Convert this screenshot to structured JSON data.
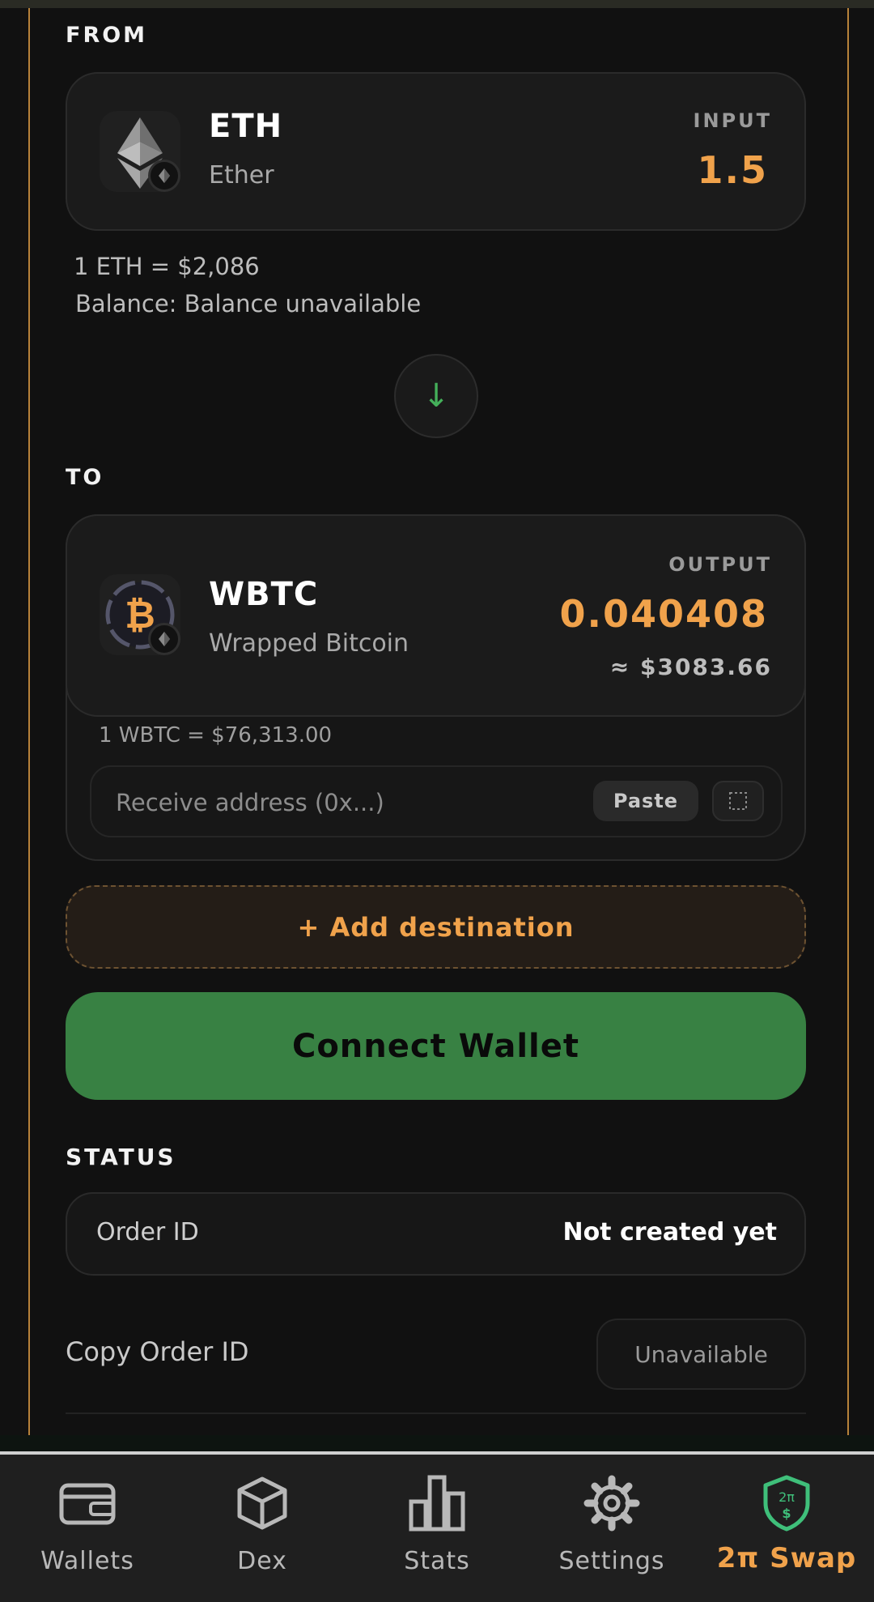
{
  "from": {
    "section_label": "FROM",
    "token_symbol": "ETH",
    "token_name": "Ether",
    "io_label": "INPUT",
    "amount": "1.5",
    "rate": "1 ETH = $2,086",
    "balance": "Balance: Balance unavailable"
  },
  "swap_direction_icon": "arrow-down-icon",
  "to": {
    "section_label": "TO",
    "token_symbol": "WBTC",
    "token_name": "Wrapped Bitcoin",
    "io_label": "OUTPUT",
    "amount": "0.040408",
    "usd_value": "≈ $3083.66",
    "rate": "1 WBTC = $76,313.00",
    "address_placeholder": "Receive address (0x...)",
    "paste_label": "Paste"
  },
  "add_destination_label": "+ Add destination",
  "connect_wallet_label": "Connect Wallet",
  "status": {
    "section_label": "STATUS",
    "order_id_label": "Order ID",
    "order_id_value": "Not created yet",
    "copy_label": "Copy Order ID",
    "copy_button": "Unavailable"
  },
  "nav": {
    "items": [
      {
        "label": "Wallets",
        "icon": "wallet-icon"
      },
      {
        "label": "Dex",
        "icon": "cube-icon"
      },
      {
        "label": "Stats",
        "icon": "bar-chart-icon"
      },
      {
        "label": "Settings",
        "icon": "gear-icon"
      },
      {
        "label": "2π Swap",
        "icon": "shield-icon",
        "active": true
      }
    ]
  },
  "colors": {
    "accent_orange": "#f0a24b",
    "accent_green": "#388143",
    "frame_border": "#b7823a",
    "background": "#111111"
  }
}
